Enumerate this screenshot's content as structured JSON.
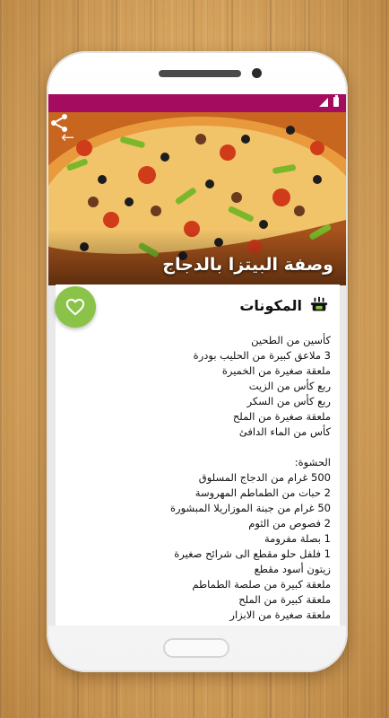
{
  "app": {
    "title": "وصفة البيتزا بالدجاج",
    "accent_color": "#a40c60",
    "fab_color": "#8bc34a"
  },
  "toolbar": {
    "back_icon": "arrow-left-icon",
    "share_icon": "share-icon"
  },
  "fab": {
    "icon": "heart-outline-icon"
  },
  "ingredients": {
    "icon": "cooking-pot-icon",
    "heading": "المكونات",
    "dough": [
      "كأسين من الطحين",
      "3 ملاعق كبيرة من الحليب بودرة",
      "ملعقة صغيرة من الخميرة",
      "ربع كأس من الزيت",
      "ربع كأس من السكر",
      "ملعقة صغيرة من الملح",
      "كأس من الماء الدافئ"
    ],
    "filling_heading": "الحشوة:",
    "filling": [
      "500 غرام من الدجاج المسلوق",
      "2 حبات من الطماطم المهروسة",
      "50 غرام من جبنة الموزاريلا المبشورة",
      "2 فصوص من الثوم",
      "1 بصلة مفرومة",
      "1 فلفل حلو مقطع الى شرائح صغيرة",
      "زيتون أسود مقطع",
      "ملعقة كبيرة من صلصة الطماطم",
      "ملعقة كبيرة من الملح",
      "ملعقة صغيرة من الابزار"
    ]
  }
}
